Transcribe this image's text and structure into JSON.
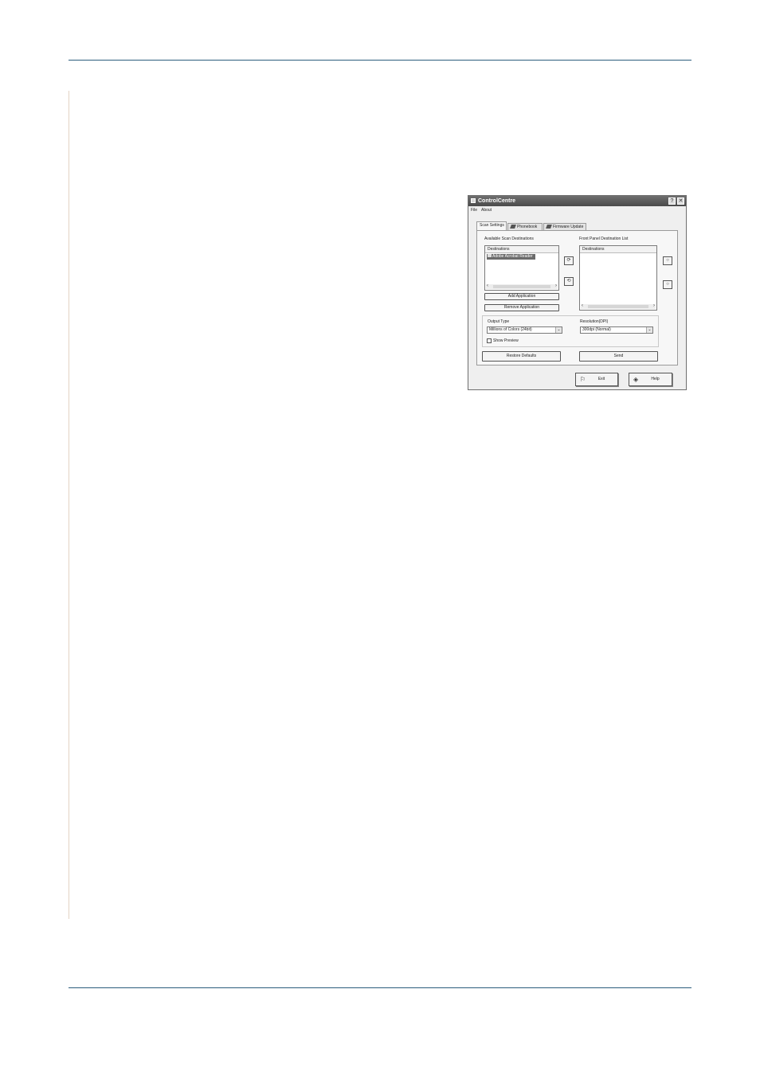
{
  "window": {
    "title": "ControlCentre",
    "help_glyph": "?",
    "close_glyph": "✕"
  },
  "menu": {
    "file": "File",
    "about": "About"
  },
  "tabs": [
    {
      "label": "Scan Settings",
      "active": true
    },
    {
      "label": "Phonebook",
      "icon": "phonebook-icon"
    },
    {
      "label": "Firmware Update",
      "icon": "firmware-icon"
    }
  ],
  "scan": {
    "available_label": "Available Scan Destinations",
    "front_panel_label": "Front Panel Destination List",
    "available_list": {
      "header": "Destinations",
      "items": [
        "Adobe Acrobat Reader"
      ]
    },
    "front_list": {
      "header": "Destinations",
      "items": []
    },
    "add_application": "Add Application",
    "remove_application": "Remove Application",
    "output_type_label": "Output Type",
    "output_type_value": "Millions of Colors (24bit)",
    "resolution_label": "Resolution(DPI)",
    "resolution_value": "300dpi (Normal)",
    "show_preview": "Show Preview",
    "show_preview_checked": false,
    "restore_defaults": "Restore Defaults",
    "send": "Send"
  },
  "footer": {
    "exit": "Exit",
    "help": "Help"
  },
  "icons": {
    "move_right": "arrow-right-icon",
    "move_left": "arrow-left-icon",
    "move_up": "arrow-up-icon",
    "move_down": "arrow-down-icon"
  }
}
